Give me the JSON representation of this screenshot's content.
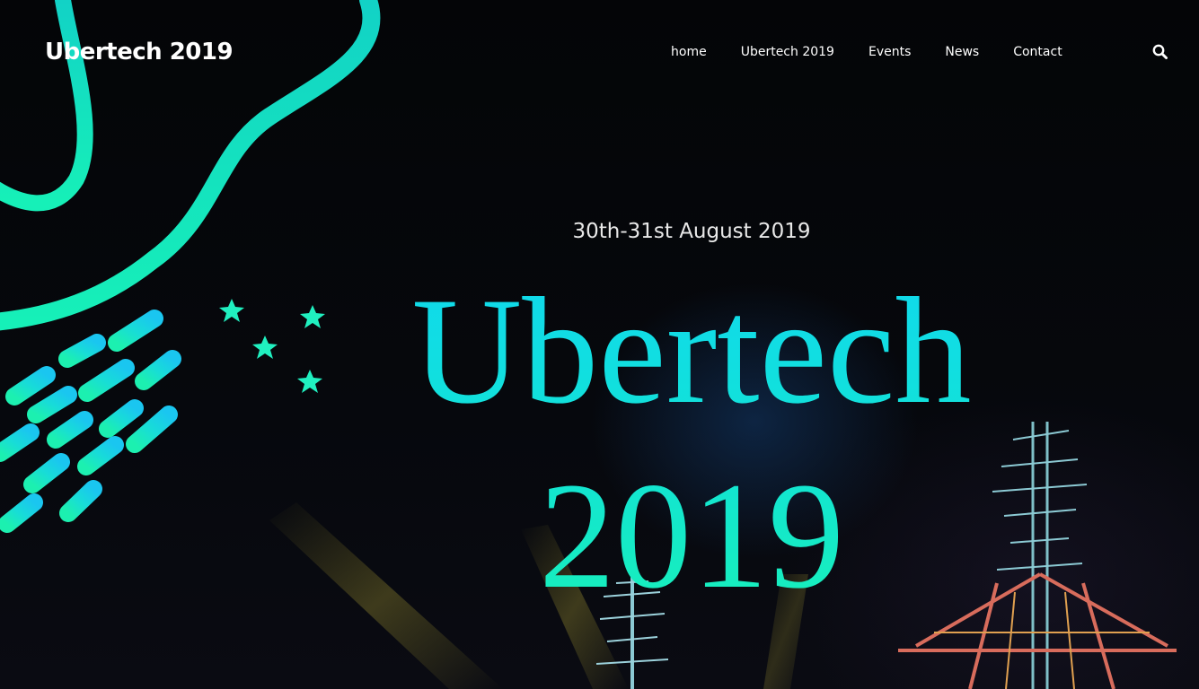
{
  "site": {
    "logo": "Ubertech 2019"
  },
  "nav": {
    "items": [
      {
        "label": "home"
      },
      {
        "label": "Ubertech 2019"
      },
      {
        "label": "Events"
      },
      {
        "label": "News"
      },
      {
        "label": "Contact"
      }
    ],
    "search_icon": "search-icon"
  },
  "hero": {
    "date": "30th-31st August 2019",
    "title": "Ubertech 2019"
  },
  "colors": {
    "background": "#05060a",
    "accent_cyan": "#00d8f0",
    "accent_green": "#18f0b8",
    "text": "#ffffff"
  }
}
